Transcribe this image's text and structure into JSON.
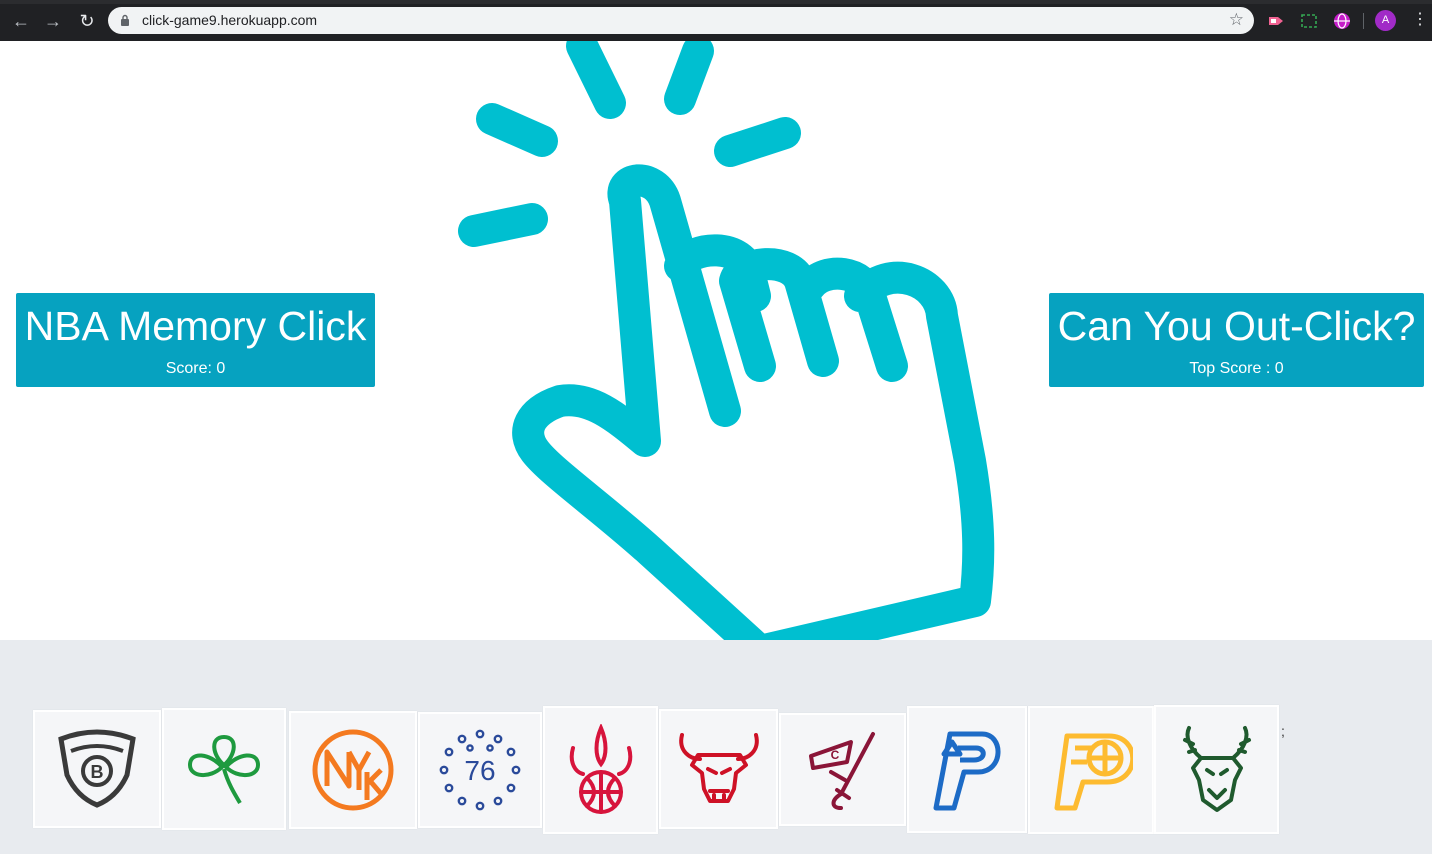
{
  "browser": {
    "url": "click-game9.herokuapp.com",
    "profile_initial": "A",
    "nav": {
      "back": "←",
      "forward": "→",
      "reload": "↻"
    },
    "star": "☆",
    "menu": "⋮"
  },
  "game": {
    "title": "NBA Memory Click",
    "score_label": "Score: 0",
    "challenge": "Can You Out-Click?",
    "top_score_label": "Top Score : 0"
  },
  "cards": [
    {
      "name": "nets",
      "icon": "brooklyn-nets-logo-icon",
      "color": "#3a3a3a"
    },
    {
      "name": "celtics",
      "icon": "celtics-shamrock-logo-icon",
      "color": "#1e9a3f"
    },
    {
      "name": "knicks",
      "icon": "knicks-nyk-logo-icon",
      "color": "#f47a20"
    },
    {
      "name": "76ers",
      "icon": "sixers-76-logo-icon",
      "color": "#2a4a9a",
      "text": "76"
    },
    {
      "name": "raptors",
      "icon": "raptors-claw-logo-icon",
      "color": "#d7143c"
    },
    {
      "name": "bulls",
      "icon": "bulls-logo-icon",
      "color": "#ce1126"
    },
    {
      "name": "cavaliers",
      "icon": "cavaliers-sword-logo-icon",
      "color": "#8a1538",
      "text": "C"
    },
    {
      "name": "pistons",
      "icon": "pistons-p-logo-icon",
      "color": "#1d6bc6"
    },
    {
      "name": "pacers",
      "icon": "pacers-p-logo-icon",
      "color": "#fdbb30"
    },
    {
      "name": "bucks",
      "icon": "bucks-deer-logo-icon",
      "color": "#1f5a2e"
    }
  ],
  "stray_text": ";",
  "colors": {
    "accent": "#06a2c0",
    "hand": "#00bfd0",
    "tray": "#e8ebef"
  }
}
